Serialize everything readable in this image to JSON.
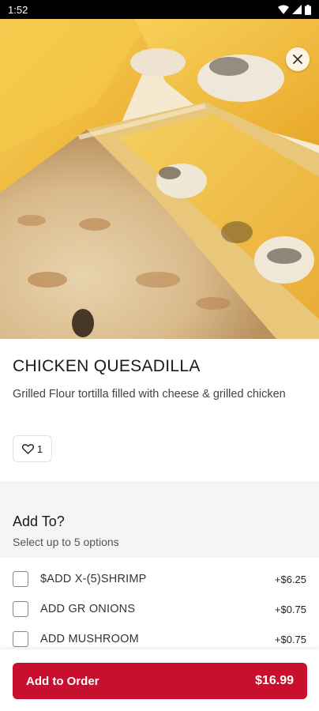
{
  "status_bar": {
    "time": "1:52"
  },
  "item": {
    "name": "CHICKEN QUESADILLA",
    "description": "Grilled Flour tortilla filled with cheese & grilled chicken",
    "likes": "1"
  },
  "modifier_group": {
    "title": "Add To?",
    "subtitle": "Select up to 5 options",
    "options": [
      {
        "label": "$ADD X-(5)SHRIMP",
        "price": "+$6.25"
      },
      {
        "label": "ADD GR ONIONS",
        "price": "+$0.75"
      },
      {
        "label": "ADD MUSHROOM",
        "price": "+$0.75"
      }
    ]
  },
  "footer": {
    "button_label": "Add to Order",
    "total": "$16.99"
  },
  "colors": {
    "accent": "#c8102e",
    "group_background": "#f5f5f5"
  },
  "icons": [
    "wifi-icon",
    "signal-icon",
    "battery-icon",
    "close-icon",
    "heart-icon"
  ]
}
